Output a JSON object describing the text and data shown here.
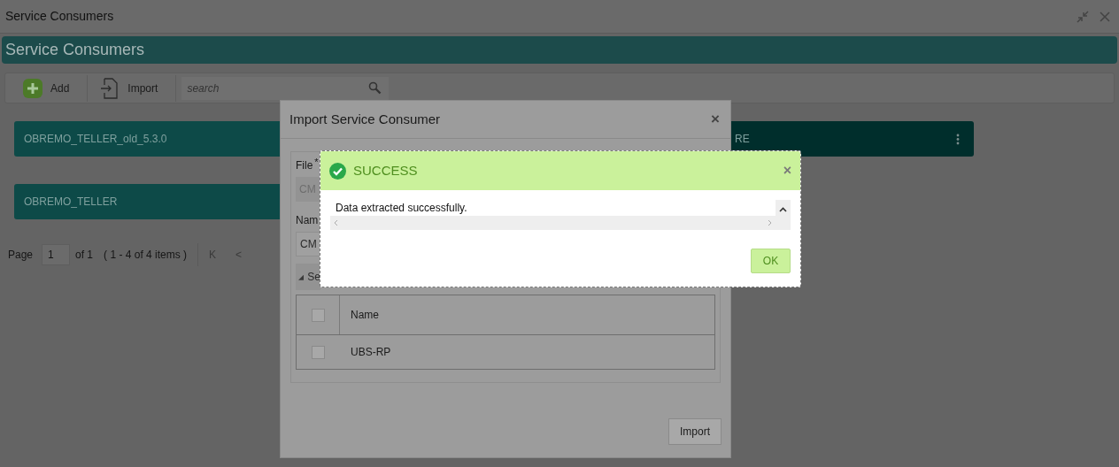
{
  "window": {
    "title": "Service Consumers"
  },
  "header": {
    "title": "Service Consumers"
  },
  "toolbar": {
    "buttons": [
      {
        "label": "Add",
        "kind": "add"
      },
      {
        "label": "Import",
        "kind": "import"
      }
    ],
    "search": {
      "placeholder": "search"
    }
  },
  "cards": [
    {
      "label": "OBREMO_TELLER_old_5.3.0",
      "menu": false
    },
    {
      "label": "RE",
      "menu": true
    },
    {
      "label": "OBREMO_TELLER",
      "menu": false
    }
  ],
  "pagination": {
    "page_label": "Page",
    "page": "1",
    "of": "of 1",
    "summary": "( 1 - 4 of 4 items )",
    "first": "K",
    "prev": "<"
  },
  "import_dialog": {
    "title": "Import Service Consumer",
    "close": "×",
    "file_label": "File",
    "required": "*",
    "file_value": "CM",
    "name_label": "Nam",
    "name_value": "CM",
    "section": "Se",
    "expanded": true,
    "table": {
      "columns": [
        "Name"
      ],
      "header_checked": false,
      "rows": [
        {
          "name": "UBS-RP",
          "checked": false
        }
      ]
    },
    "button": "Import"
  },
  "success_dialog": {
    "title": "SUCCESS",
    "close": "×",
    "message": "Data extracted successfully.",
    "button": "OK"
  }
}
